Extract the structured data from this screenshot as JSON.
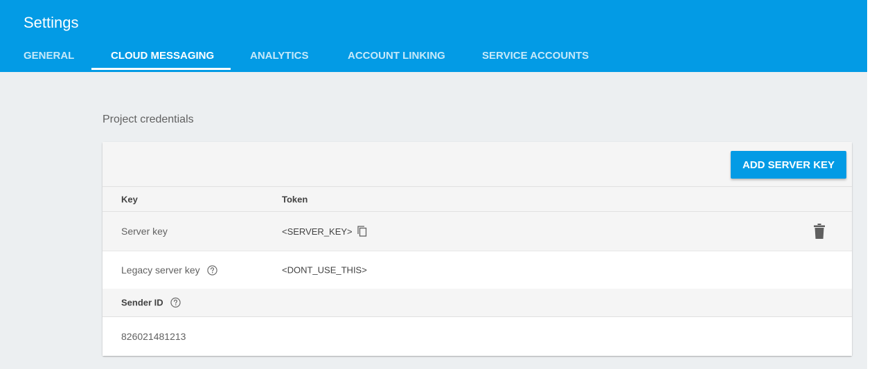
{
  "header": {
    "title": "Settings",
    "tabs": [
      {
        "label": "GENERAL"
      },
      {
        "label": "CLOUD MESSAGING",
        "active": true
      },
      {
        "label": "ANALYTICS"
      },
      {
        "label": "ACCOUNT LINKING"
      },
      {
        "label": "SERVICE ACCOUNTS"
      }
    ]
  },
  "section": {
    "label": "Project credentials"
  },
  "card": {
    "add_button_label": "ADD SERVER KEY",
    "columns": {
      "key": "Key",
      "token": "Token"
    },
    "rows": [
      {
        "key": "Server key",
        "token": "<SERVER_KEY>",
        "icon": "copy-icon",
        "action_icon": "trash-icon"
      },
      {
        "key": "Legacy server key",
        "token": "<DONT_USE_THIS>",
        "icon": "help-icon"
      }
    ],
    "sender": {
      "label": "Sender ID",
      "icon": "help-icon",
      "value": "826021481213"
    }
  },
  "colors": {
    "header_bg": "#039be5",
    "page_bg": "#eceff1",
    "card_bg": "#ffffff",
    "button_bg": "#039be5"
  }
}
